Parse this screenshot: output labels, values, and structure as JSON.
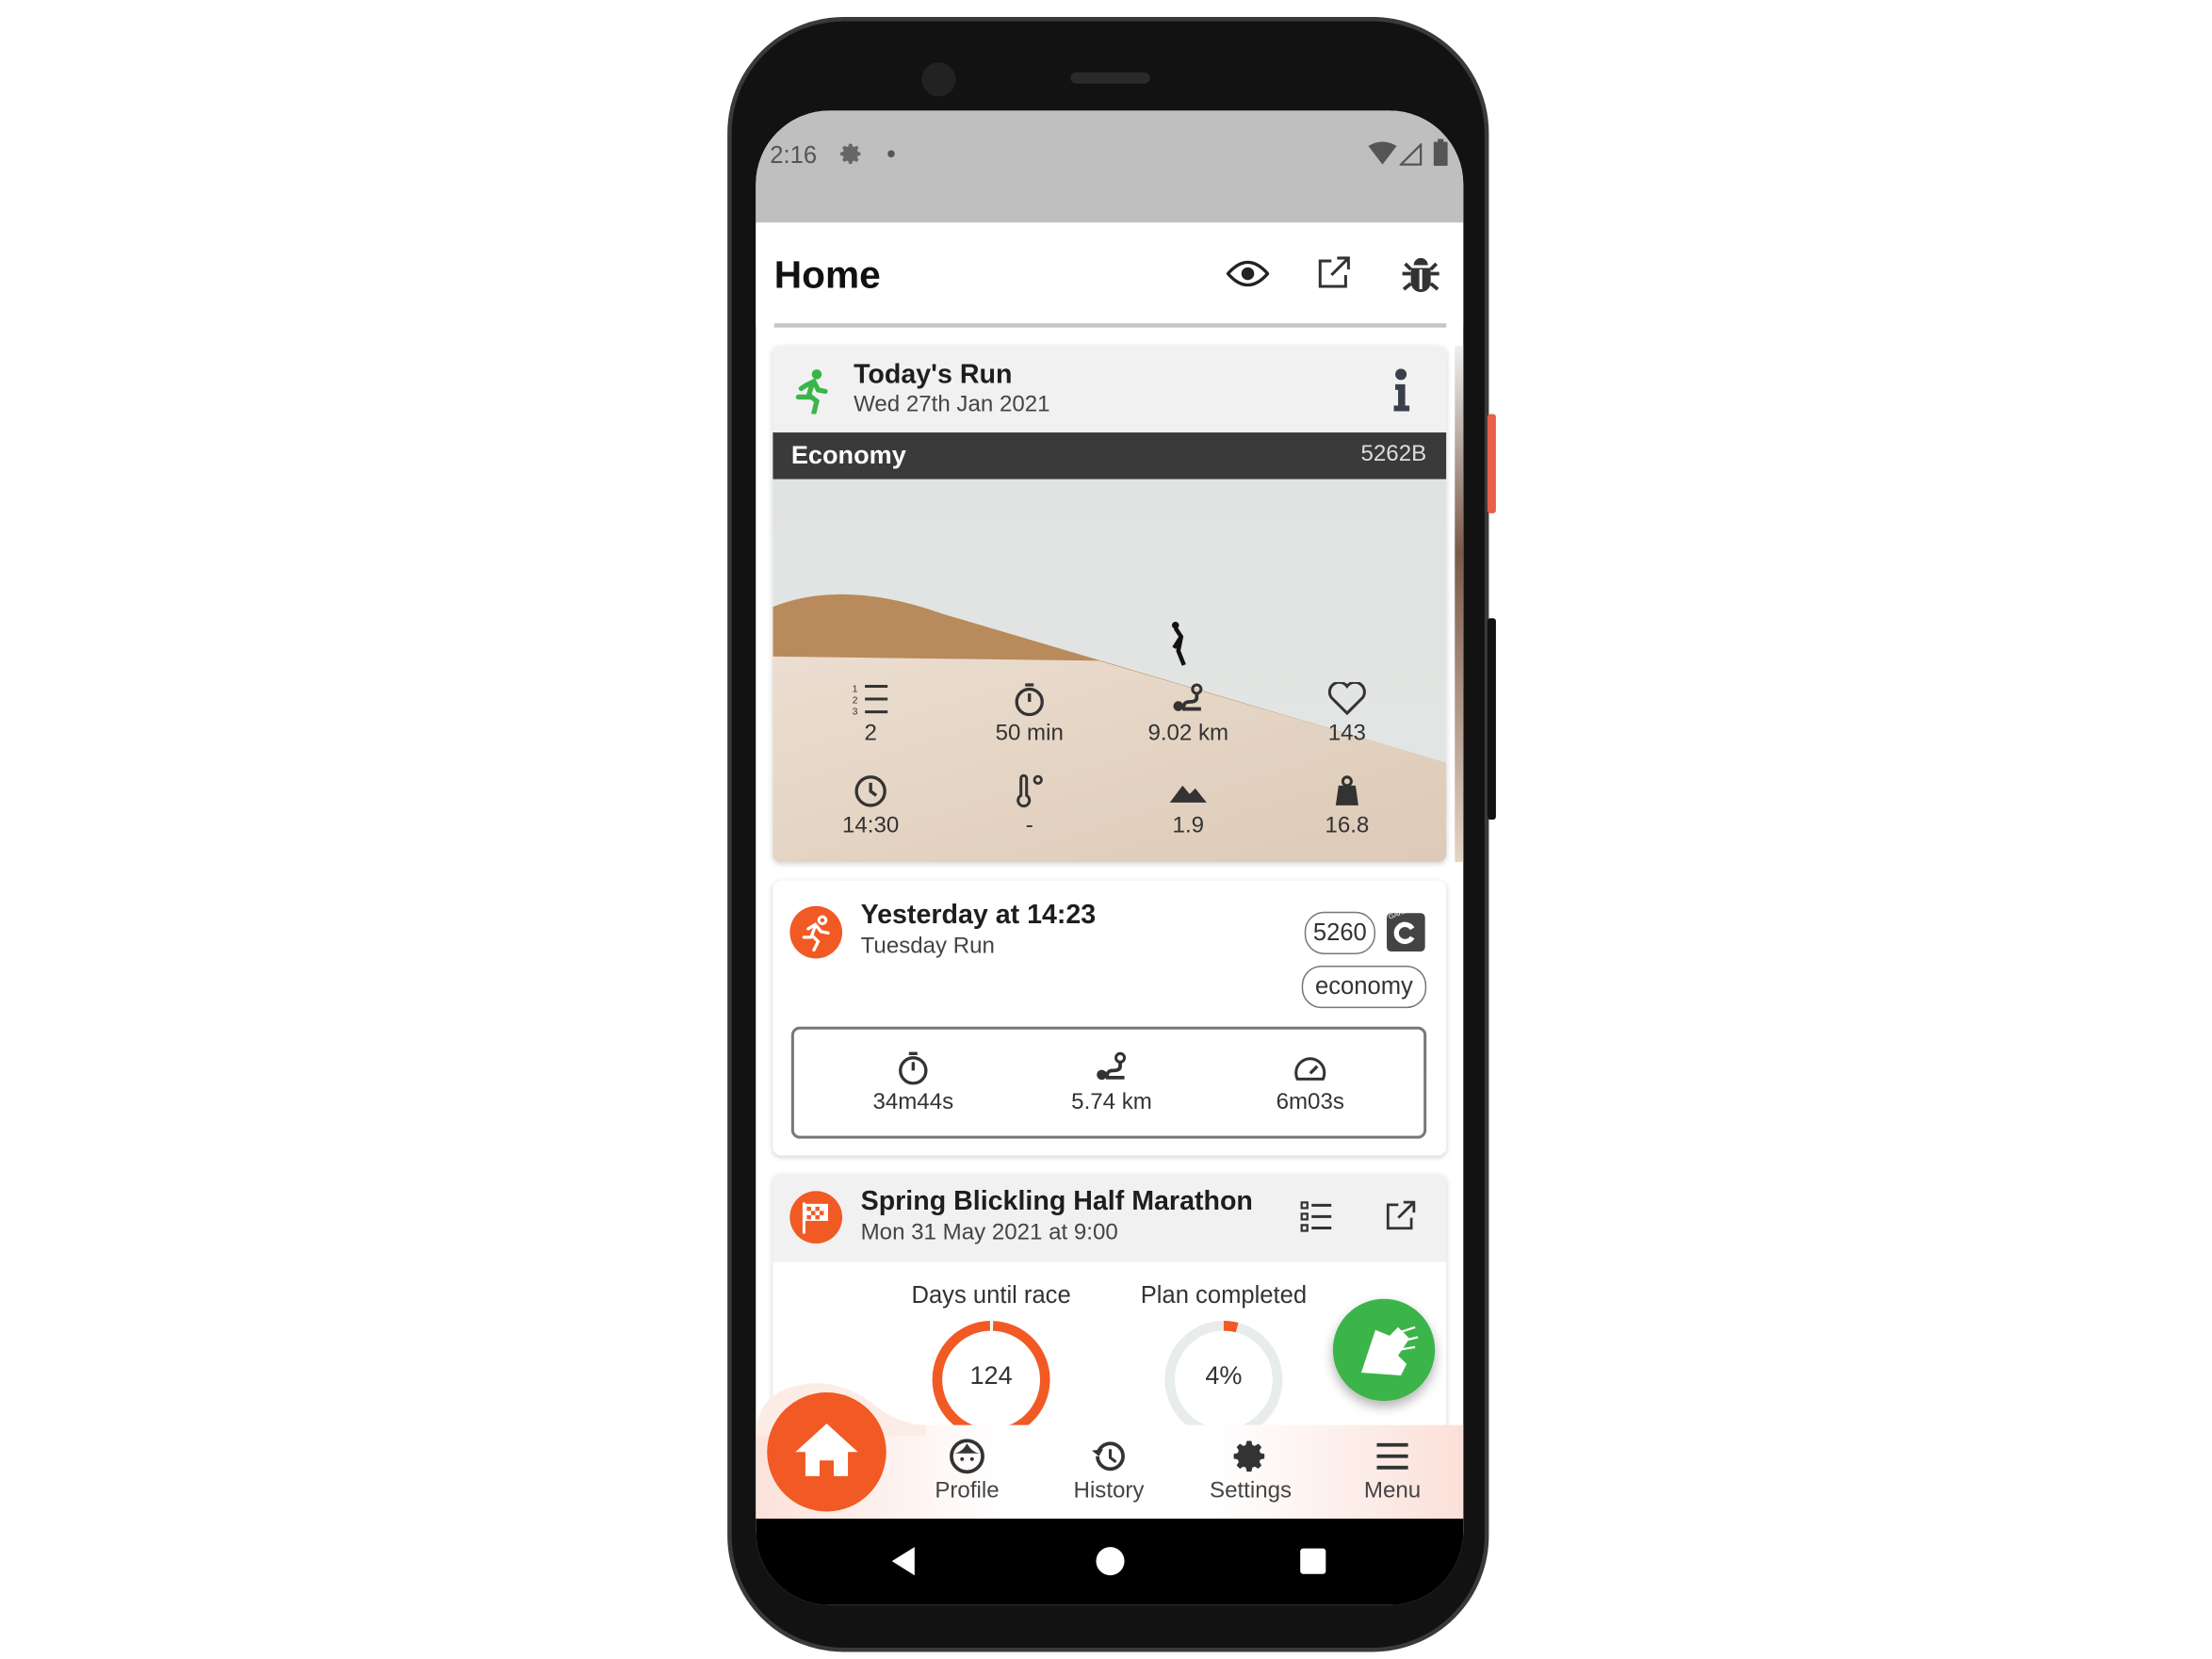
{
  "status_bar": {
    "time": "2:16",
    "icons": [
      "settings-icon",
      "dot-icon",
      "wifi-icon",
      "signal-icon",
      "battery-icon"
    ]
  },
  "header": {
    "title": "Home",
    "actions": [
      "eye-icon",
      "external-link-icon",
      "bug-icon"
    ]
  },
  "todays_run": {
    "title": "Today's Run",
    "date": "Wed 27th  Jan 2021",
    "workout_type": "Economy",
    "workout_code": "5262B",
    "stats": [
      {
        "icon": "list-icon",
        "value": "2"
      },
      {
        "icon": "stopwatch-icon",
        "value": "50 min"
      },
      {
        "icon": "route-icon",
        "value": "9.02 km"
      },
      {
        "icon": "heart-icon",
        "value": "143"
      },
      {
        "icon": "clock-icon",
        "value": "14:30"
      },
      {
        "icon": "thermometer-icon",
        "value": "-"
      },
      {
        "icon": "mountain-icon",
        "value": "1.9"
      },
      {
        "icon": "weight-icon",
        "value": "16.8"
      }
    ]
  },
  "yesterday": {
    "title": "Yesterday at 14:23",
    "subtitle": "Tuesday Run",
    "code_badge": "5260",
    "source": "GARMIN",
    "type_badge": "economy",
    "stats": [
      {
        "icon": "stopwatch-icon",
        "value": "34m44s"
      },
      {
        "icon": "route-icon",
        "value": "5.74 km"
      },
      {
        "icon": "speedometer-icon",
        "value": "6m03s"
      }
    ]
  },
  "race": {
    "title": "Spring Blickling Half Marathon",
    "date": "Mon 31 May 2021 at 9:00",
    "days_label": "Days until race",
    "days_value": "124",
    "days_ring_fraction": 0.99,
    "plan_label": "Plan completed",
    "plan_value": "4%",
    "plan_fraction": 0.04
  },
  "bottom_nav": {
    "items": [
      {
        "label": "Profile",
        "icon": "face-icon"
      },
      {
        "label": "History",
        "icon": "history-icon"
      },
      {
        "label": "Settings",
        "icon": "gear-icon"
      },
      {
        "label": "Menu",
        "icon": "hamburger-icon"
      }
    ],
    "home_icon": "home-icon"
  },
  "colors": {
    "accent": "#f15a24",
    "green": "#3bb54a",
    "dark_band": "#3a3a3a"
  }
}
